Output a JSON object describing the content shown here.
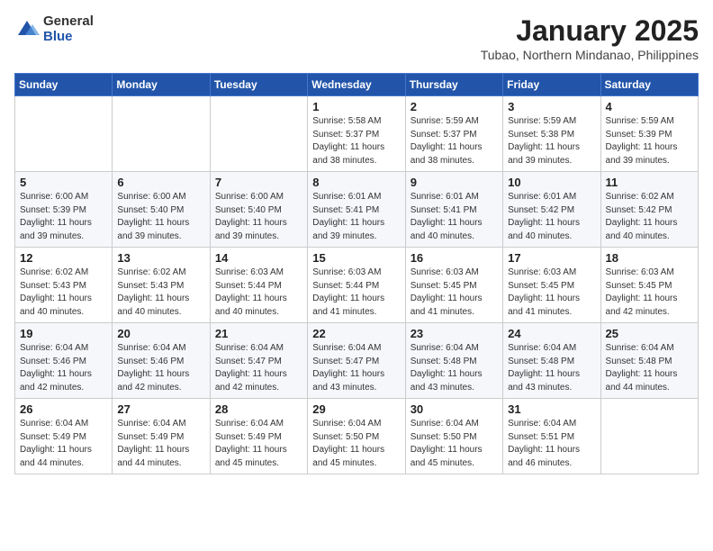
{
  "header": {
    "logo_general": "General",
    "logo_blue": "Blue",
    "month_title": "January 2025",
    "subtitle": "Tubao, Northern Mindanao, Philippines"
  },
  "days_of_week": [
    "Sunday",
    "Monday",
    "Tuesday",
    "Wednesday",
    "Thursday",
    "Friday",
    "Saturday"
  ],
  "weeks": [
    [
      {
        "day": "",
        "info": ""
      },
      {
        "day": "",
        "info": ""
      },
      {
        "day": "",
        "info": ""
      },
      {
        "day": "1",
        "info": "Sunrise: 5:58 AM\nSunset: 5:37 PM\nDaylight: 11 hours\nand 38 minutes."
      },
      {
        "day": "2",
        "info": "Sunrise: 5:59 AM\nSunset: 5:37 PM\nDaylight: 11 hours\nand 38 minutes."
      },
      {
        "day": "3",
        "info": "Sunrise: 5:59 AM\nSunset: 5:38 PM\nDaylight: 11 hours\nand 39 minutes."
      },
      {
        "day": "4",
        "info": "Sunrise: 5:59 AM\nSunset: 5:39 PM\nDaylight: 11 hours\nand 39 minutes."
      }
    ],
    [
      {
        "day": "5",
        "info": "Sunrise: 6:00 AM\nSunset: 5:39 PM\nDaylight: 11 hours\nand 39 minutes."
      },
      {
        "day": "6",
        "info": "Sunrise: 6:00 AM\nSunset: 5:40 PM\nDaylight: 11 hours\nand 39 minutes."
      },
      {
        "day": "7",
        "info": "Sunrise: 6:00 AM\nSunset: 5:40 PM\nDaylight: 11 hours\nand 39 minutes."
      },
      {
        "day": "8",
        "info": "Sunrise: 6:01 AM\nSunset: 5:41 PM\nDaylight: 11 hours\nand 39 minutes."
      },
      {
        "day": "9",
        "info": "Sunrise: 6:01 AM\nSunset: 5:41 PM\nDaylight: 11 hours\nand 40 minutes."
      },
      {
        "day": "10",
        "info": "Sunrise: 6:01 AM\nSunset: 5:42 PM\nDaylight: 11 hours\nand 40 minutes."
      },
      {
        "day": "11",
        "info": "Sunrise: 6:02 AM\nSunset: 5:42 PM\nDaylight: 11 hours\nand 40 minutes."
      }
    ],
    [
      {
        "day": "12",
        "info": "Sunrise: 6:02 AM\nSunset: 5:43 PM\nDaylight: 11 hours\nand 40 minutes."
      },
      {
        "day": "13",
        "info": "Sunrise: 6:02 AM\nSunset: 5:43 PM\nDaylight: 11 hours\nand 40 minutes."
      },
      {
        "day": "14",
        "info": "Sunrise: 6:03 AM\nSunset: 5:44 PM\nDaylight: 11 hours\nand 40 minutes."
      },
      {
        "day": "15",
        "info": "Sunrise: 6:03 AM\nSunset: 5:44 PM\nDaylight: 11 hours\nand 41 minutes."
      },
      {
        "day": "16",
        "info": "Sunrise: 6:03 AM\nSunset: 5:45 PM\nDaylight: 11 hours\nand 41 minutes."
      },
      {
        "day": "17",
        "info": "Sunrise: 6:03 AM\nSunset: 5:45 PM\nDaylight: 11 hours\nand 41 minutes."
      },
      {
        "day": "18",
        "info": "Sunrise: 6:03 AM\nSunset: 5:45 PM\nDaylight: 11 hours\nand 42 minutes."
      }
    ],
    [
      {
        "day": "19",
        "info": "Sunrise: 6:04 AM\nSunset: 5:46 PM\nDaylight: 11 hours\nand 42 minutes."
      },
      {
        "day": "20",
        "info": "Sunrise: 6:04 AM\nSunset: 5:46 PM\nDaylight: 11 hours\nand 42 minutes."
      },
      {
        "day": "21",
        "info": "Sunrise: 6:04 AM\nSunset: 5:47 PM\nDaylight: 11 hours\nand 42 minutes."
      },
      {
        "day": "22",
        "info": "Sunrise: 6:04 AM\nSunset: 5:47 PM\nDaylight: 11 hours\nand 43 minutes."
      },
      {
        "day": "23",
        "info": "Sunrise: 6:04 AM\nSunset: 5:48 PM\nDaylight: 11 hours\nand 43 minutes."
      },
      {
        "day": "24",
        "info": "Sunrise: 6:04 AM\nSunset: 5:48 PM\nDaylight: 11 hours\nand 43 minutes."
      },
      {
        "day": "25",
        "info": "Sunrise: 6:04 AM\nSunset: 5:48 PM\nDaylight: 11 hours\nand 44 minutes."
      }
    ],
    [
      {
        "day": "26",
        "info": "Sunrise: 6:04 AM\nSunset: 5:49 PM\nDaylight: 11 hours\nand 44 minutes."
      },
      {
        "day": "27",
        "info": "Sunrise: 6:04 AM\nSunset: 5:49 PM\nDaylight: 11 hours\nand 44 minutes."
      },
      {
        "day": "28",
        "info": "Sunrise: 6:04 AM\nSunset: 5:49 PM\nDaylight: 11 hours\nand 45 minutes."
      },
      {
        "day": "29",
        "info": "Sunrise: 6:04 AM\nSunset: 5:50 PM\nDaylight: 11 hours\nand 45 minutes."
      },
      {
        "day": "30",
        "info": "Sunrise: 6:04 AM\nSunset: 5:50 PM\nDaylight: 11 hours\nand 45 minutes."
      },
      {
        "day": "31",
        "info": "Sunrise: 6:04 AM\nSunset: 5:51 PM\nDaylight: 11 hours\nand 46 minutes."
      },
      {
        "day": "",
        "info": ""
      }
    ]
  ]
}
